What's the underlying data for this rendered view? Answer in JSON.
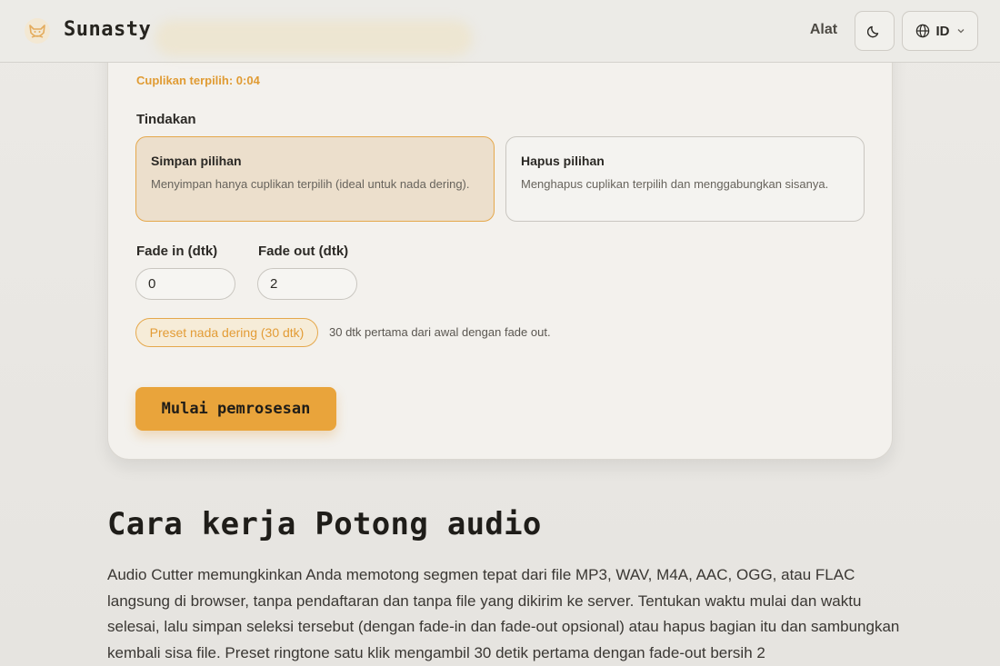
{
  "header": {
    "brand": "Sunasty",
    "nav_tools": "Alat",
    "theme_icon": "moon-icon",
    "language": "ID",
    "language_icon": "globe-icon",
    "language_chevron": "chevron-down-icon"
  },
  "editor": {
    "selected_clip": "Cuplikan terpilih: 0:04",
    "actions_label": "Tindakan",
    "actions": [
      {
        "title": "Simpan pilihan",
        "description": "Menyimpan hanya cuplikan terpilih (ideal untuk nada dering).",
        "selected": true
      },
      {
        "title": "Hapus pilihan",
        "description": "Menghapus cuplikan terpilih dan menggabungkan sisanya.",
        "selected": false
      }
    ],
    "fade_in_label": "Fade in (dtk)",
    "fade_in_value": "0",
    "fade_out_label": "Fade out (dtk)",
    "fade_out_value": "2",
    "preset_label": "Preset nada dering (30 dtk)",
    "preset_note": "30 dtk pertama dari awal dengan fade out.",
    "start_label": "Mulai pemrosesan"
  },
  "how_it_works": {
    "title": "Cara kerja Potong audio",
    "body": "Audio Cutter memungkinkan Anda memotong segmen tepat dari file MP3, WAV, M4A, AAC, OGG, atau FLAC langsung di browser, tanpa pendaftaran dan tanpa file yang dikirim ke server. Tentukan waktu mulai dan waktu selesai, lalu simpan seleksi tersebut (dengan fade-in dan fade-out opsional) atau hapus bagian itu dan sambungkan kembali sisa file. Preset ringtone satu klik mengambil 30 detik pertama dengan fade-out bersih 2"
  },
  "colors": {
    "accent": "#e9a43b",
    "accent_text": "#e09b33",
    "selected_card_bg": "#ecdfcc",
    "background": "#e7e5e1"
  }
}
